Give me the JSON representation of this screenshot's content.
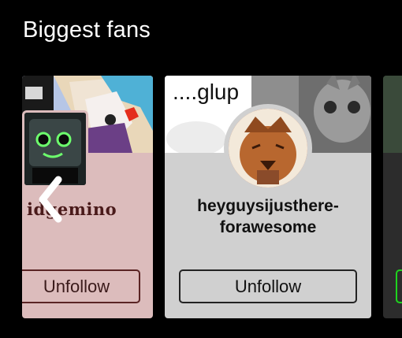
{
  "section": {
    "title": "Biggest fans"
  },
  "cards": [
    {
      "name": "idgemino",
      "button_label": "Unfollow"
    },
    {
      "name_line1": "heyguysijusthere-",
      "name_line2": "forawesome",
      "button_label": "Unfollow"
    },
    {
      "button_label": ""
    }
  ],
  "banner_texts": {
    "card2_top_text": "....glup"
  },
  "icons": {
    "back": "chevron-left-icon"
  },
  "colors": {
    "background": "#000000",
    "card1_bg": "#dcbcbc",
    "card2_bg": "#d0d0d0",
    "accent_green": "#1ed41e"
  }
}
